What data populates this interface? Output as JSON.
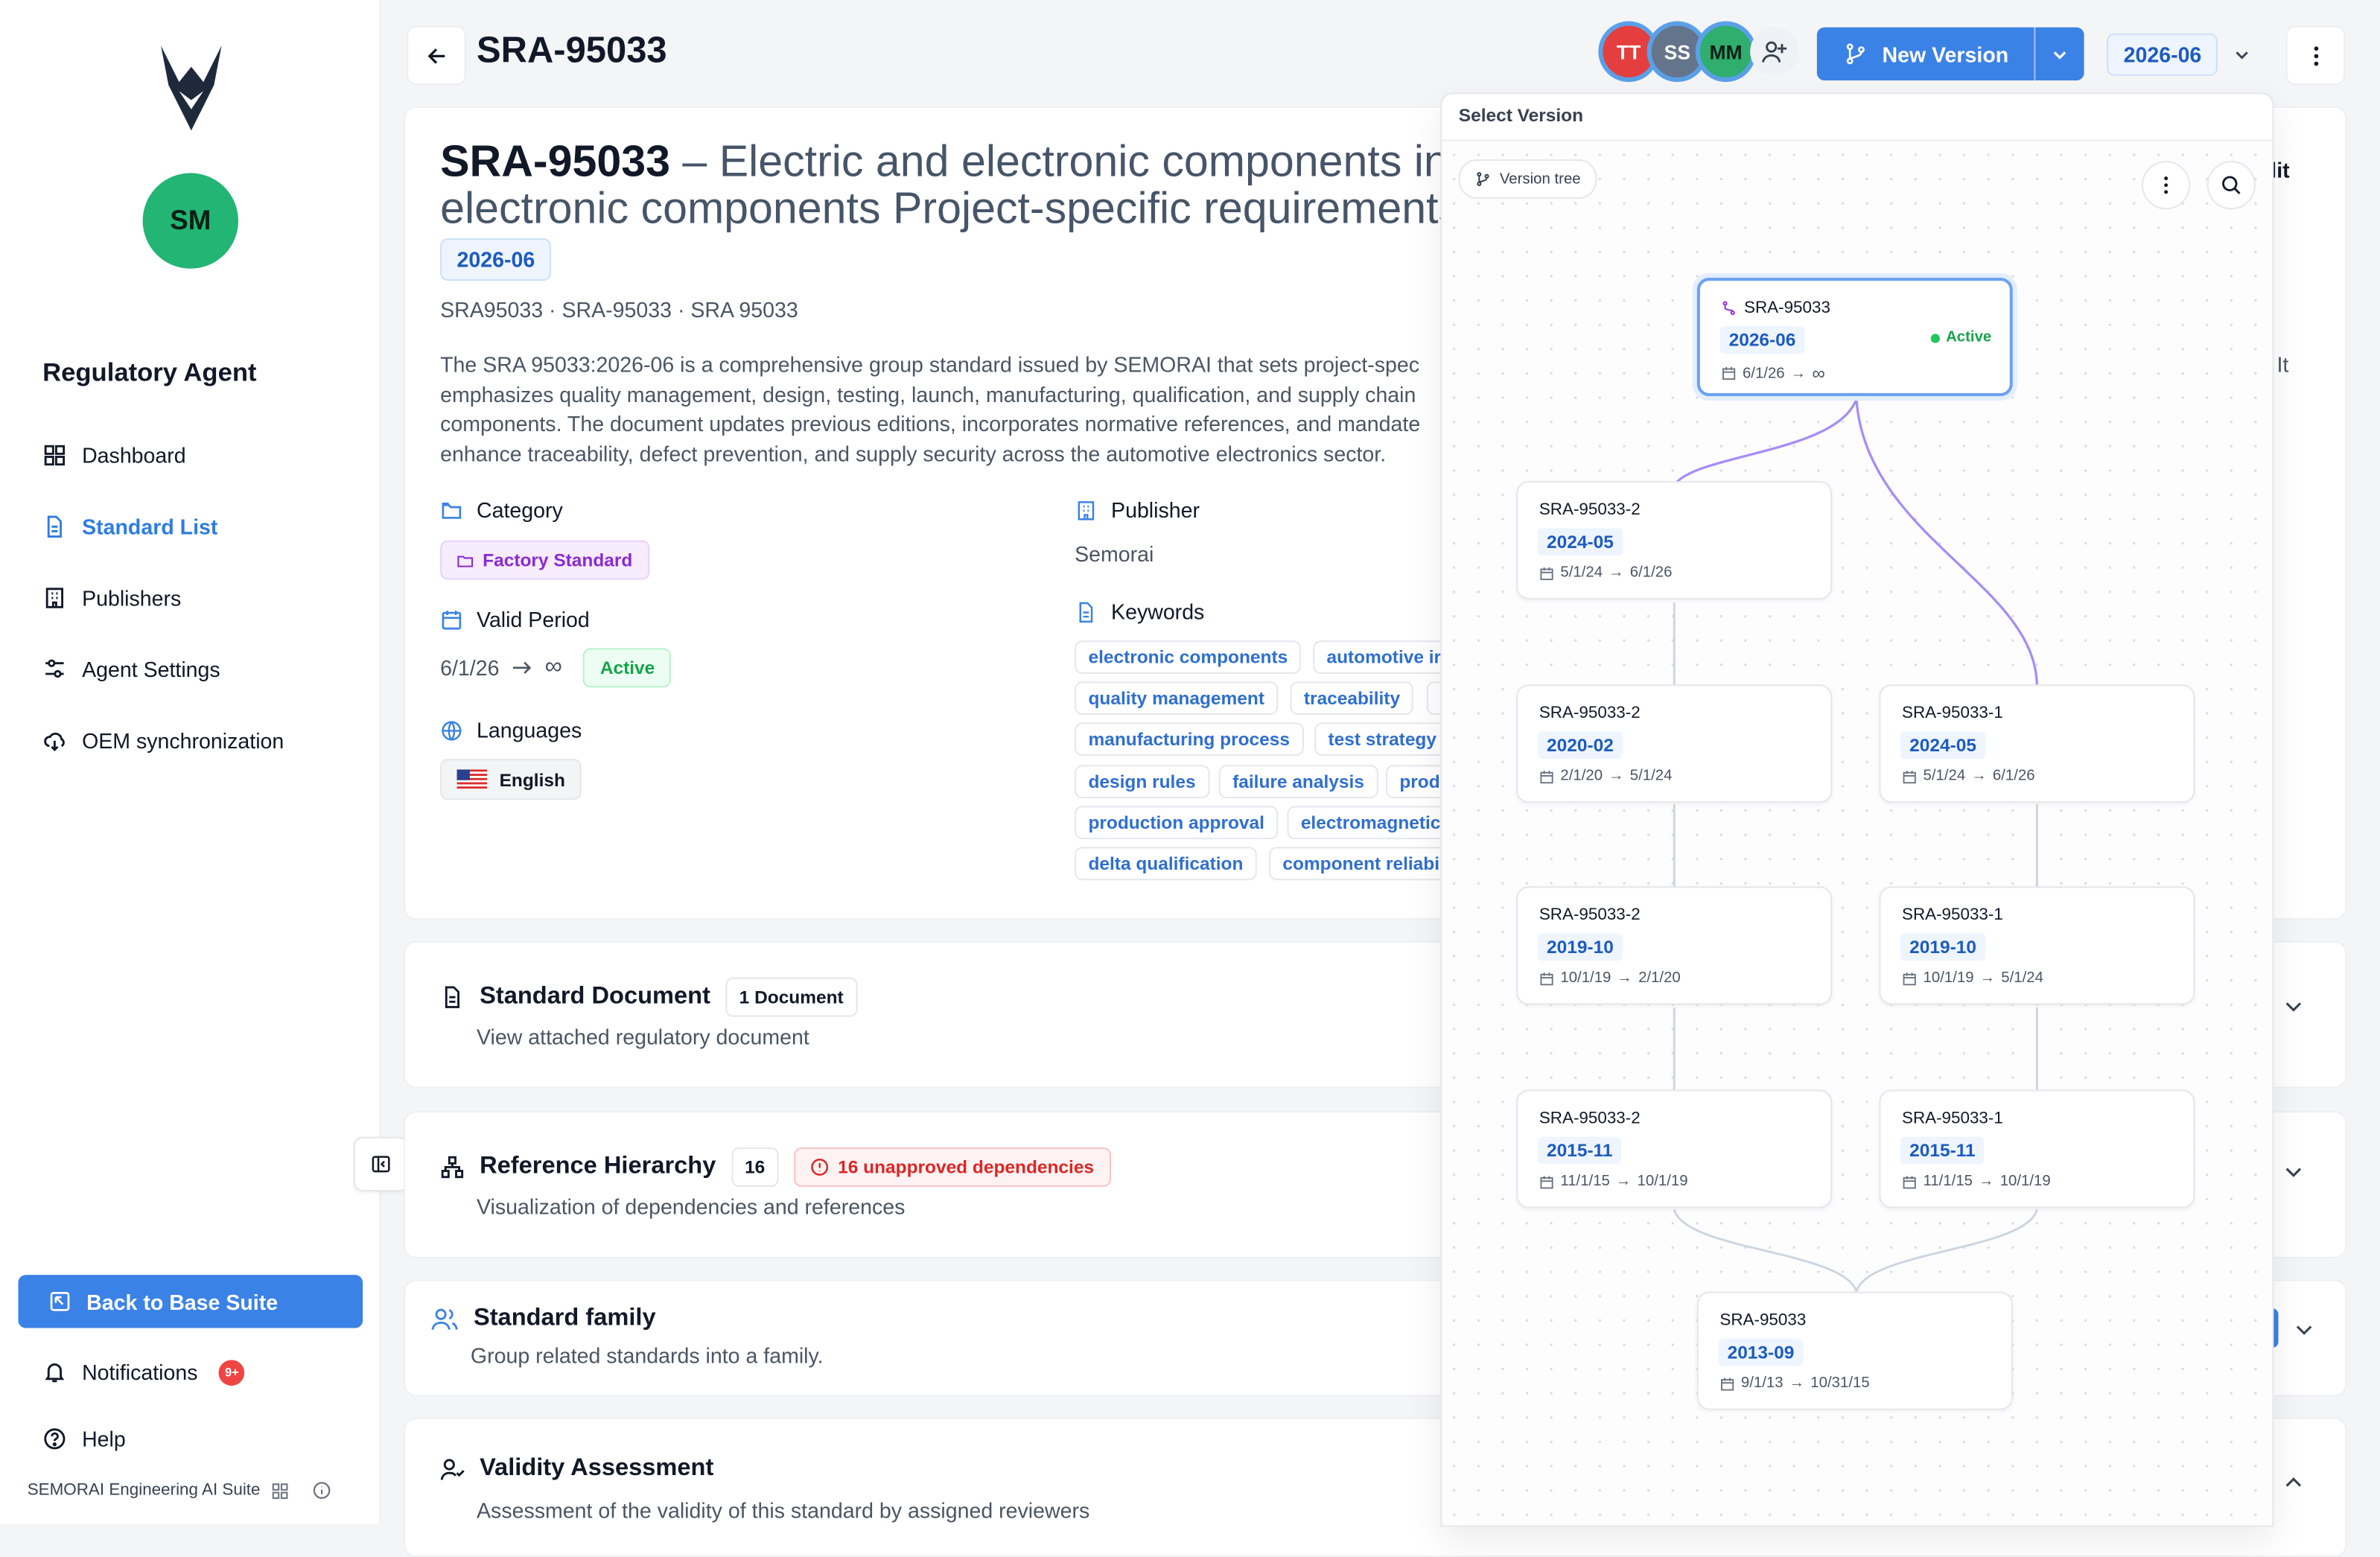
{
  "sidebar": {
    "logo_initials": "SM",
    "app_title": "Regulatory Agent",
    "nav": [
      {
        "label": "Dashboard",
        "icon": "grid-icon"
      },
      {
        "label": "Standard List",
        "icon": "document-icon",
        "active": true
      },
      {
        "label": "Publishers",
        "icon": "building-icon"
      },
      {
        "label": "Agent Settings",
        "icon": "sliders-icon"
      },
      {
        "label": "OEM synchronization",
        "icon": "cloud-sync-icon"
      }
    ],
    "back_label": "Back to Base Suite",
    "notifications_label": "Notifications",
    "notifications_badge": "9+",
    "help_label": "Help",
    "footer": "SEMORAI Engineering AI Suite"
  },
  "header": {
    "title": "SRA-95033",
    "collaborators": [
      "TT",
      "SS",
      "MM"
    ],
    "new_version_label": "New Version",
    "version_value": "2026-06"
  },
  "standard": {
    "code": "SRA-95033",
    "title_rest": " – Electric and electronic components in",
    "title_line2": "electronic components Project-specific requirements",
    "version": "2026-06",
    "aliases": "SRA95033 · SRA-95033 · SRA 95033",
    "description": [
      "The SRA 95033:2026-06 is a comprehensive group standard issued by SEMORAI that sets project-spec",
      "emphasizes quality management, design, testing, launch, manufacturing, qualification, and supply chain",
      "components. The document updates previous editions, incorporates normative references, and mandate",
      "enhance traceability, defect prevention, and supply security across the automotive electronics sector."
    ],
    "category_label": "Category",
    "category_value": "Factory Standard",
    "valid_label": "Valid Period",
    "valid_from": "6/1/26",
    "valid_to": "∞",
    "valid_status": "Active",
    "languages_label": "Languages",
    "language": "English",
    "publisher_label": "Publisher",
    "publisher": "Semorai",
    "keywords_label": "Keywords",
    "keywords": [
      [
        "electronic components",
        "automotive ir"
      ],
      [
        "quality management",
        "traceability"
      ],
      [
        "manufacturing process",
        "test strategy"
      ],
      [
        "design rules",
        "failure analysis",
        "prod"
      ],
      [
        "production approval",
        "electromagnetic"
      ],
      [
        "delta qualification",
        "component reliabi"
      ]
    ],
    "edit_fragment": "lit",
    "it_fragment": "It"
  },
  "sections": {
    "doc_title": "Standard Document",
    "doc_count": "1 Document",
    "doc_sub": "View attached regulatory document",
    "ref_title": "Reference Hierarchy",
    "ref_count": "16",
    "ref_warning": "16 unapproved dependencies",
    "ref_sub": "Visualization of dependencies and references",
    "family_title": "Standard family",
    "family_sub": "Group related standards into a family.",
    "validity_title": "Validity Assessment",
    "validity_sub": "Assessment of the validity of this standard by assigned reviewers"
  },
  "version_popover": {
    "header": "Select Version",
    "tree_chip": "Version tree",
    "active_label": "Active",
    "nodes": [
      {
        "id": "n0",
        "name": "SRA-95033",
        "version": "2026-06",
        "from": "6/1/26",
        "to": "∞",
        "active": true
      },
      {
        "id": "n1",
        "name": "SRA-95033-2",
        "version": "2024-05",
        "from": "5/1/24",
        "to": "6/1/26"
      },
      {
        "id": "n2",
        "name": "SRA-95033-2",
        "version": "2020-02",
        "from": "2/1/20",
        "to": "5/1/24"
      },
      {
        "id": "n3",
        "name": "SRA-95033-1",
        "version": "2024-05",
        "from": "5/1/24",
        "to": "6/1/26"
      },
      {
        "id": "n4",
        "name": "SRA-95033-2",
        "version": "2019-10",
        "from": "10/1/19",
        "to": "2/1/20"
      },
      {
        "id": "n5",
        "name": "SRA-95033-1",
        "version": "2019-10",
        "from": "10/1/19",
        "to": "5/1/24"
      },
      {
        "id": "n6",
        "name": "SRA-95033-2",
        "version": "2015-11",
        "from": "11/1/15",
        "to": "10/1/19"
      },
      {
        "id": "n7",
        "name": "SRA-95033-1",
        "version": "2015-11",
        "from": "11/1/15",
        "to": "10/1/19"
      },
      {
        "id": "n8",
        "name": "SRA-95033",
        "version": "2013-09",
        "from": "9/1/13",
        "to": "10/31/15"
      }
    ]
  },
  "colors": {
    "accent": "#3b82e6",
    "active": "#16a34a",
    "danger": "#dc2626",
    "purple": "#9333ea"
  }
}
